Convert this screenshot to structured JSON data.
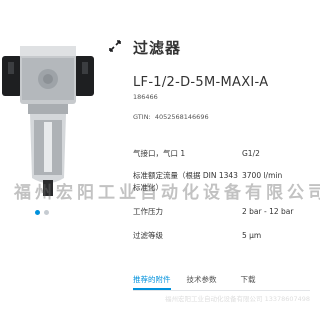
{
  "product": {
    "title": "过滤器",
    "model": "LF-1/2-D-5M-MAXI-A",
    "part_number": "186466",
    "gtin_label": "GTIN:",
    "gtin_value": "4052568146696"
  },
  "specs": [
    {
      "label": "气接口，气口 1",
      "value": "G1/2"
    },
    {
      "label": "标准额定流量（根据 DIN 1343 标准化）",
      "value": "3700 l/min"
    },
    {
      "label": "工作压力",
      "value": "2 bar - 12 bar"
    },
    {
      "label": "过滤等级",
      "value": "5 µm"
    }
  ],
  "tabs": [
    {
      "label": "推荐的附件",
      "active": true
    },
    {
      "label": "技术参数",
      "active": false
    },
    {
      "label": "下载",
      "active": false
    }
  ],
  "carousel": {
    "count": 2,
    "active_index": 0
  },
  "icons": {
    "expand": "expand-arrows-icon"
  },
  "colors": {
    "accent": "#0091dc",
    "text": "#333333",
    "body_metal": "#b8bcc0"
  },
  "watermark": {
    "main": "福州宏阳工业自动化设备有限公司",
    "faint": "福州宏阳工业自动化设备有限公司 13378607498"
  }
}
